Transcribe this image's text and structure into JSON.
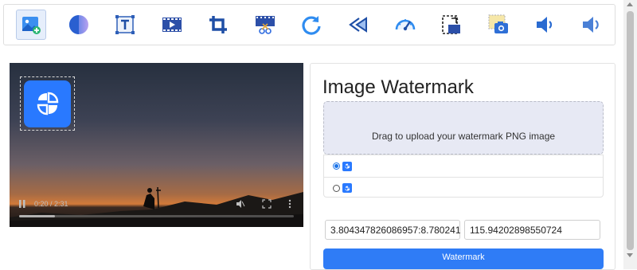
{
  "toolbar": {
    "tools": [
      {
        "icon": "add-image-icon",
        "active": true
      },
      {
        "icon": "filter-icon"
      },
      {
        "icon": "text-icon"
      },
      {
        "icon": "film-icon"
      },
      {
        "icon": "crop-icon"
      },
      {
        "icon": "cut-video-icon"
      },
      {
        "icon": "rotate-icon"
      },
      {
        "icon": "rewind-icon"
      },
      {
        "icon": "speedometer-icon"
      },
      {
        "icon": "resize-icon"
      },
      {
        "icon": "snapshot-icon"
      },
      {
        "icon": "volume-down-icon"
      },
      {
        "icon": "volume-up-icon"
      }
    ]
  },
  "video": {
    "time": "0:20 / 2:31",
    "progress": 0.13
  },
  "panel": {
    "title": "Image Watermark",
    "dropzone_text": "Drag to upload your watermark PNG image",
    "watermarks": [
      {
        "selected": true
      },
      {
        "selected": false
      }
    ],
    "position_value": "3.804347826086957:8.780241",
    "size_value": "115.94202898550724",
    "submit_label": "Watermark"
  },
  "colors": {
    "accent": "#2f7cf6",
    "logo_blue": "#2979ff",
    "dropzone_bg": "#e7e9f4"
  }
}
